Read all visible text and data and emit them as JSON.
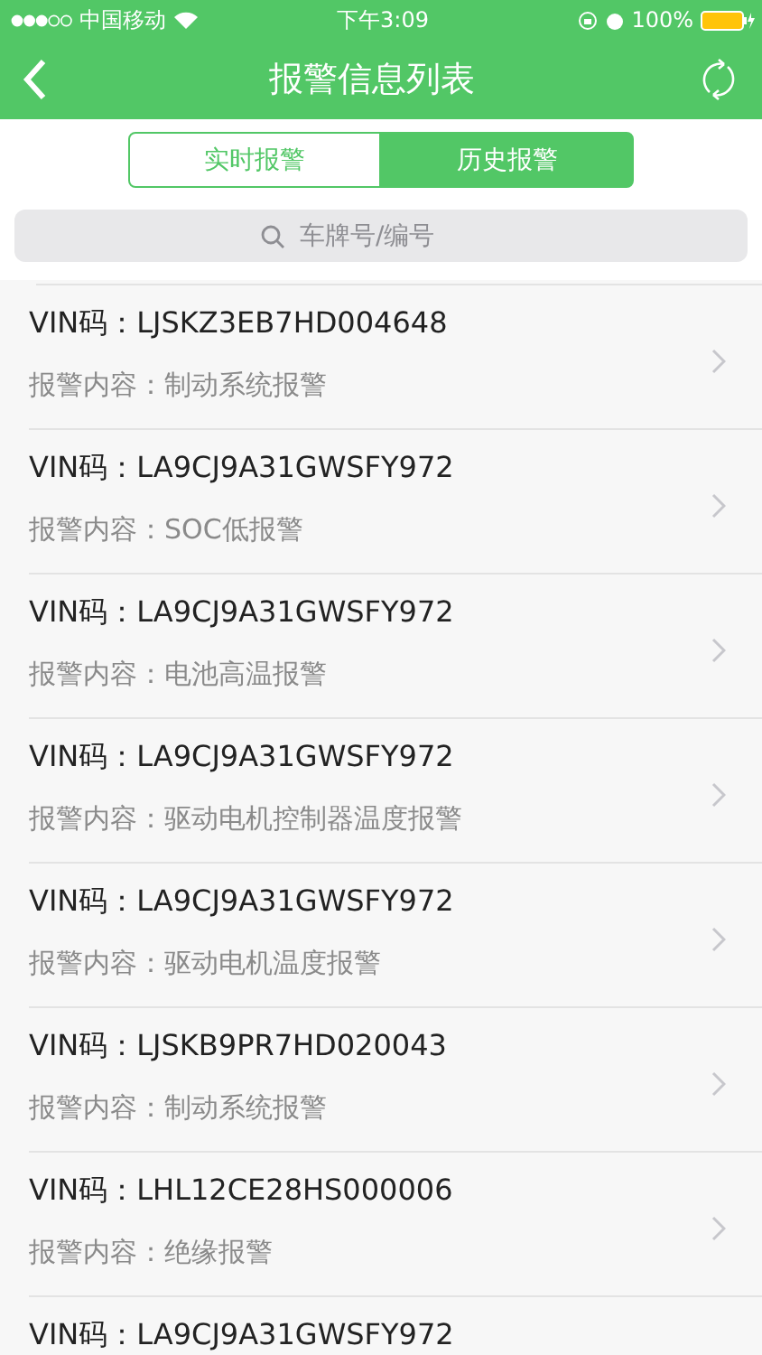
{
  "status_bar": {
    "carrier": "中国移动",
    "time": "下午3:09",
    "battery": "100%"
  },
  "nav": {
    "title": "报警信息列表"
  },
  "tabs": [
    {
      "label": "实时报警",
      "selected": false
    },
    {
      "label": "历史报警",
      "selected": true
    }
  ],
  "search": {
    "placeholder": "车牌号/编号"
  },
  "alarms": [
    {
      "vin": "VIN码：LJSKZ3EB7HD004648",
      "content": "报警内容：制动系统报警"
    },
    {
      "vin": "VIN码：LA9CJ9A31GWSFY972",
      "content": "报警内容：SOC低报警"
    },
    {
      "vin": "VIN码：LA9CJ9A31GWSFY972",
      "content": "报警内容：电池高温报警"
    },
    {
      "vin": "VIN码：LA9CJ9A31GWSFY972",
      "content": "报警内容：驱动电机控制器温度报警"
    },
    {
      "vin": "VIN码：LA9CJ9A31GWSFY972",
      "content": "报警内容：驱动电机温度报警"
    },
    {
      "vin": "VIN码：LJSKB9PR7HD020043",
      "content": "报警内容：制动系统报警"
    },
    {
      "vin": "VIN码：LHL12CE28HS000006",
      "content": "报警内容：绝缘报警"
    },
    {
      "vin": "VIN码：LA9CJ9A31GWSFY972"
    }
  ]
}
